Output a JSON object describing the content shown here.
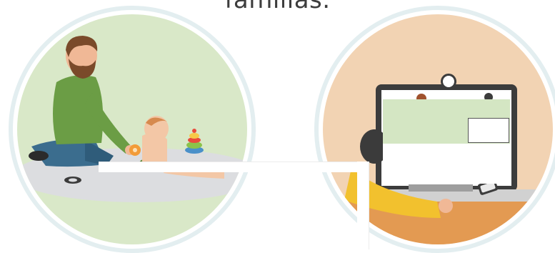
{
  "heading": {
    "text": "familias."
  },
  "illustrations": [
    {
      "name": "parent-playing-with-baby",
      "theme_color": "#d9e8c8"
    },
    {
      "name": "video-call-on-laptop",
      "theme_color": "#f2d3b3"
    }
  ],
  "colors": {
    "ring": "#e3eef0",
    "green_panel": "#d4e6c3",
    "shirt": "#6b9d45",
    "jeans": "#3b6d8e",
    "laptop": "#3c3c3c",
    "sleeve": "#f2c12e",
    "desk": "#e39a52"
  }
}
